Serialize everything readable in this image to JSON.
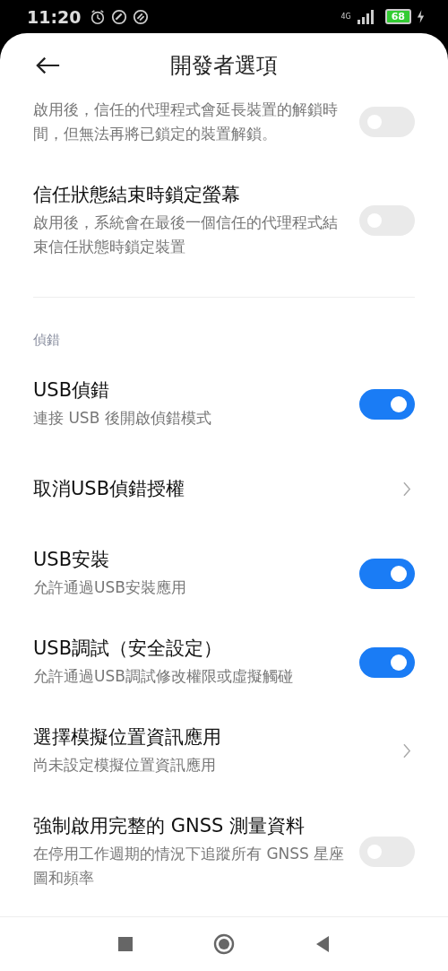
{
  "status_bar": {
    "time": "11:20",
    "network": "4G",
    "battery": "68"
  },
  "header": {
    "title": "開發者選項"
  },
  "items": [
    {
      "kind": "toggle",
      "subtitle": "啟用後，信任的代理程式會延長裝置的解鎖時間，但無法再將已鎖定的裝置解鎖。",
      "on": false
    },
    {
      "kind": "toggle",
      "title": "信任狀態結束時鎖定螢幕",
      "subtitle": "啟用後，系統會在最後一個信任的代理程式結束信任狀態時鎖定裝置",
      "on": false
    },
    {
      "kind": "divider"
    },
    {
      "kind": "section",
      "title": "偵錯"
    },
    {
      "kind": "toggle",
      "title": "USB偵錯",
      "subtitle": "連接 USB 後開啟偵錯模式",
      "on": true
    },
    {
      "kind": "link",
      "title": "取消USB偵錯授權"
    },
    {
      "kind": "toggle",
      "title": "USB安裝",
      "subtitle": "允許通過USB安裝應用",
      "on": true
    },
    {
      "kind": "toggle",
      "title": "USB調試（安全設定）",
      "subtitle": "允許通過USB調試修改權限或虛擬觸碰",
      "on": true
    },
    {
      "kind": "link",
      "title": "選擇模擬位置資訊應用",
      "subtitle": "尚未設定模擬位置資訊應用"
    },
    {
      "kind": "toggle",
      "title": "強制啟用完整的 GNSS 測量資料",
      "subtitle": "在停用工作週期的情況下追蹤所有 GNSS 星座圖和頻率",
      "on": false
    }
  ]
}
